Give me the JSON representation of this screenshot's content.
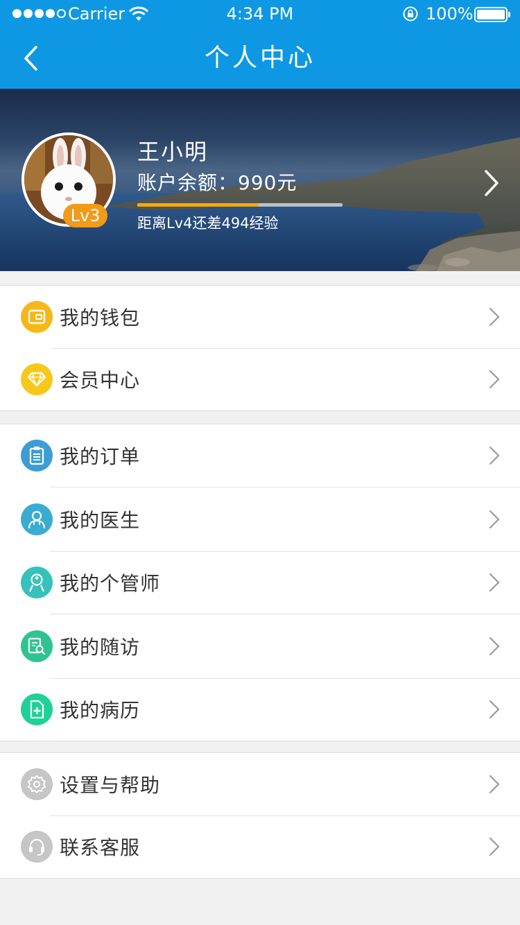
{
  "status_bar": {
    "carrier": "Carrier",
    "time": "4:34 PM",
    "battery": "100%"
  },
  "nav": {
    "title": "个人中心"
  },
  "profile": {
    "name": "王小明",
    "balance": "账户余额：990元",
    "level": "Lv3",
    "exp_text": "距离Lv4还差494经验",
    "exp_progress": 0.59
  },
  "menu_groups": [
    {
      "items": [
        {
          "label": "我的钱包",
          "icon": "wallet-icon",
          "color": "#f5b818"
        },
        {
          "label": "会员中心",
          "icon": "diamond-icon",
          "color": "#f7c81c"
        }
      ]
    },
    {
      "items": [
        {
          "label": "我的订单",
          "icon": "clipboard-icon",
          "color": "#3d9ed4"
        },
        {
          "label": "我的医生",
          "icon": "doctor-icon",
          "color": "#3aacd2"
        },
        {
          "label": "我的个管师",
          "icon": "nurse-icon",
          "color": "#36c1bb"
        },
        {
          "label": "我的随访",
          "icon": "document-search-icon",
          "color": "#2fc391"
        },
        {
          "label": "我的病历",
          "icon": "medical-record-icon",
          "color": "#1fd197"
        }
      ]
    },
    {
      "items": [
        {
          "label": "设置与帮助",
          "icon": "gear-icon",
          "color": "#c6c6c6"
        },
        {
          "label": "联系客服",
          "icon": "headset-icon",
          "color": "#c6c6c6"
        }
      ]
    }
  ],
  "colors": {
    "accent": "#0e98e4",
    "progress": "#f6a80e",
    "level_badge": "#f39a18"
  }
}
